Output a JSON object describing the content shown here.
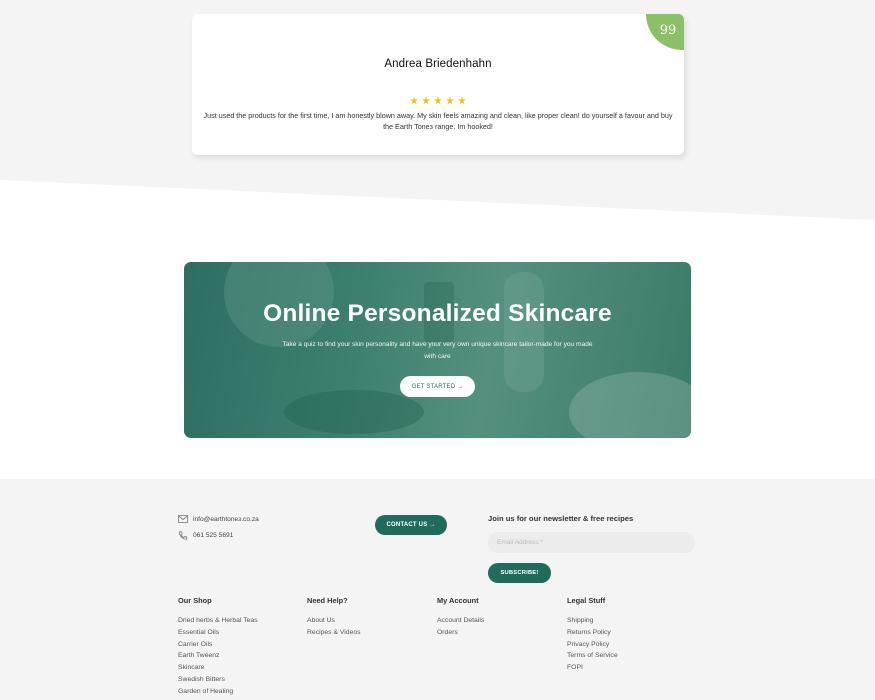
{
  "testimonial": {
    "name": "Andrea Briedenhahn",
    "stars": 5,
    "text": "Just used the products for the first time, I am honestly blown away. My skin feels amazing and clean, like proper clean! do yourself a favour and buy the Earth Toneз range. Im hooked!",
    "badge": "99"
  },
  "hero": {
    "title": "Online Personalized Skincare",
    "subtitle": "Take a quiz to find your skin personality and have your very own unique skincare tailor-made for you made with care",
    "button": "GET STARTED →"
  },
  "footer": {
    "email": "info@earthtoneз.co.za",
    "phone": "061 525 5691",
    "contact_button": "CONTACT US →",
    "newsletter_title": "Join us for our newsletter & free recipes",
    "email_placeholder": "Email Address *",
    "subscribe_button": "SUBSCRIBE!",
    "columns": [
      {
        "title": "Our Shop",
        "items": [
          "Dried herbs & Herbal Teas",
          "Essential Oils",
          "Carrier Oils",
          "Earth Tweenz",
          "Skincare",
          "Swedish Bitters",
          "Garden of Healing"
        ]
      },
      {
        "title": "Need Help?",
        "items": [
          "About Us",
          "Recipes & Videos"
        ]
      },
      {
        "title": "My Account",
        "items": [
          "Account Details",
          "Orders"
        ]
      },
      {
        "title": "Legal Stuff",
        "items": [
          "Shipping",
          "Returns Policy",
          "Privacy Policy",
          "Terms of Service",
          "FOPI"
        ]
      }
    ]
  },
  "colors": {
    "brand_green": "#216b5c",
    "badge_green": "#8cc068",
    "star": "#f2c200"
  }
}
